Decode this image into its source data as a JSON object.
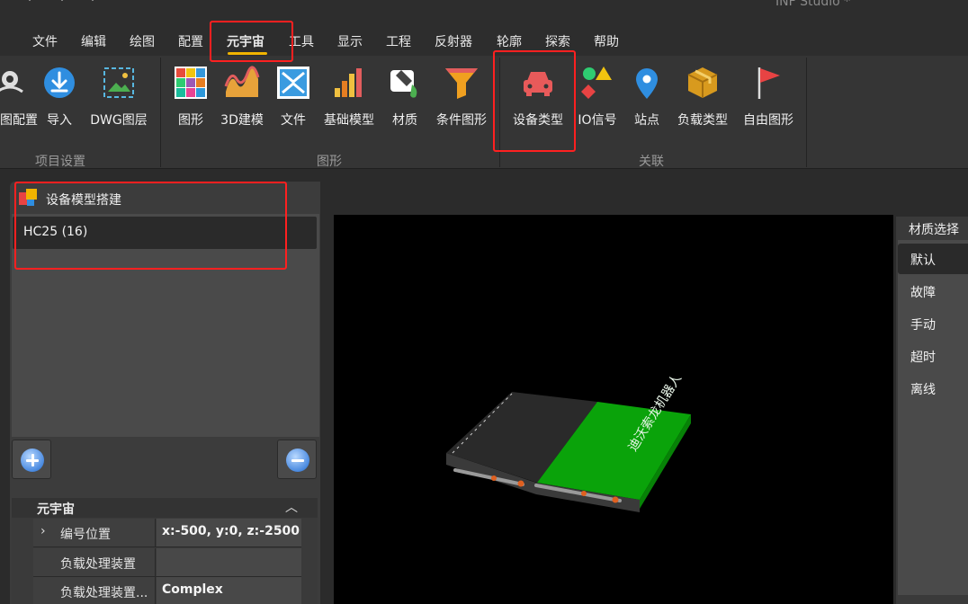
{
  "window": {
    "title": "INF Studio *"
  },
  "menu": [
    {
      "label": "文件"
    },
    {
      "label": "编辑"
    },
    {
      "label": "绘图"
    },
    {
      "label": "配置"
    },
    {
      "label": "元宇宙"
    },
    {
      "label": "工具"
    },
    {
      "label": "显示"
    },
    {
      "label": "工程"
    },
    {
      "label": "反射器"
    },
    {
      "label": "轮廓"
    },
    {
      "label": "探索"
    },
    {
      "label": "帮助"
    }
  ],
  "ribbon": {
    "project": {
      "label": "项目设置",
      "buttons": [
        "视图配置",
        "导入",
        "DWG图层"
      ]
    },
    "graphics": {
      "label": "图形",
      "buttons": [
        "图形",
        "3D建模",
        "文件",
        "基础模型",
        "材质",
        "条件图形"
      ]
    },
    "relation": {
      "label": "关联",
      "buttons": [
        "设备类型",
        "IO信号",
        "站点",
        "负载类型",
        "自由图形"
      ]
    }
  },
  "left_panel": {
    "title": "设备模型搭建",
    "selected_item": "HC25 (16)",
    "properties": {
      "section": "元宇宙",
      "rows": [
        {
          "key": "编号位置",
          "value": "x:-500, y:0, z:-2500"
        },
        {
          "key": "负载处理装置",
          "value": ""
        },
        {
          "key": "负载处理装置...",
          "value": "Complex"
        }
      ]
    }
  },
  "right_panel": {
    "title": "材质选择",
    "materials": [
      "默认",
      "故障",
      "手动",
      "超时",
      "离线"
    ],
    "selected": "默认"
  },
  "viewport": {
    "model_text": "迪沃索龙机器人"
  },
  "colors": {
    "accent": "#f0b400",
    "highlight": "#ff2020",
    "model_green": "#0aa30a"
  }
}
